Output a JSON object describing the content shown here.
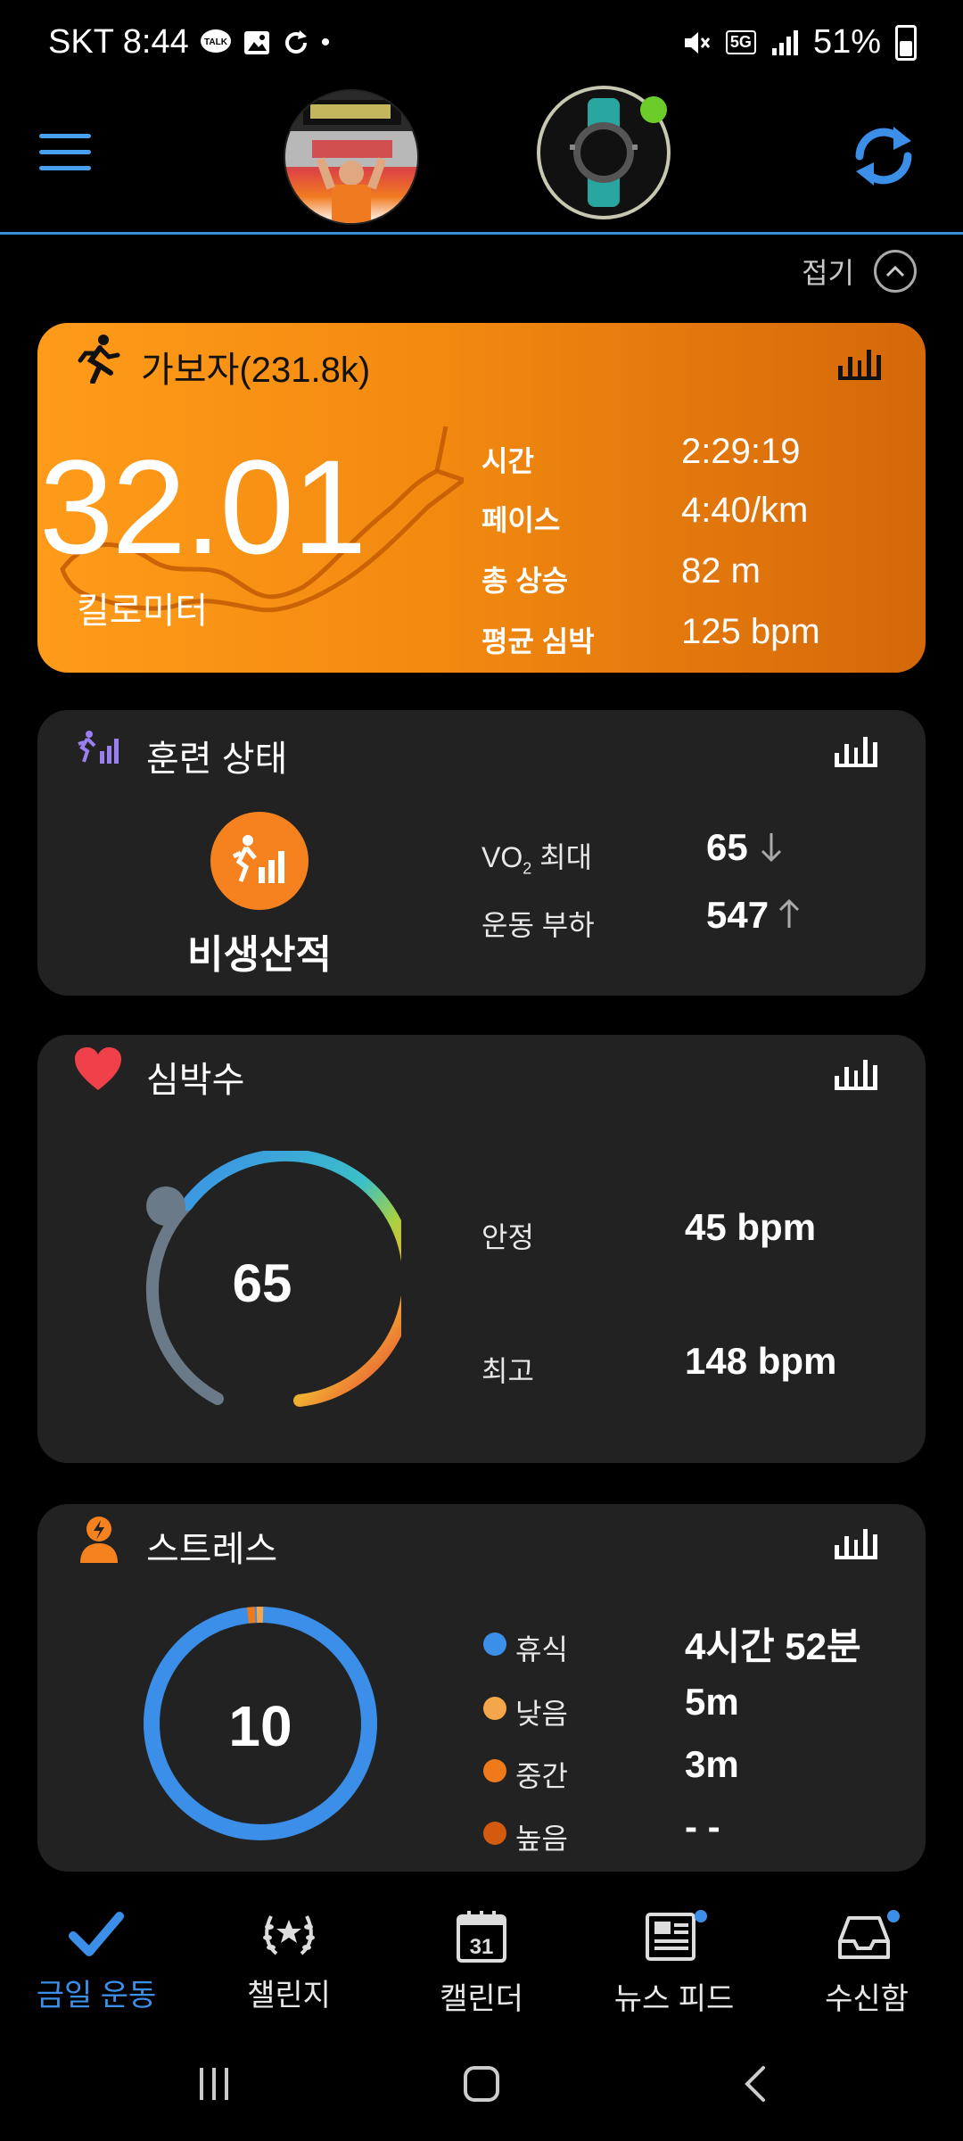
{
  "status_bar": {
    "carrier_time": "SKT 8:44",
    "network": "5G",
    "battery": "51%"
  },
  "header": {
    "avatar": "profile-photo",
    "device_connected_color": "#6ccc2a",
    "accent": "#3b8fd9"
  },
  "collapse_label": "접기",
  "activity": {
    "title": "가보자(231.8k)",
    "distance": "32.01",
    "unit": "킬로미터",
    "stats": [
      {
        "label": "시간",
        "value": "2:29:19"
      },
      {
        "label": "페이스",
        "value": "4:40/km"
      },
      {
        "label": "총 상승",
        "value": "82 m"
      },
      {
        "label": "평균 심박",
        "value": "125 bpm"
      }
    ]
  },
  "training": {
    "title": "훈련 상태",
    "status": "비생산적",
    "vo2_label_prefix": "VO",
    "vo2_label_sub": "2",
    "vo2_label_suffix": " 최대",
    "vo2_value": "65",
    "load_label": "운동 부하",
    "load_value": "547"
  },
  "heart": {
    "title": "심박수",
    "current": "65",
    "resting_label": "안정",
    "resting_value": "45 bpm",
    "max_label": "최고",
    "max_value": "148 bpm"
  },
  "stress": {
    "title": "스트레스",
    "value": "10",
    "items": [
      {
        "label": "휴식",
        "value": "4시간 52분",
        "color": "#3b8fe8"
      },
      {
        "label": "낮음",
        "value": "5m",
        "color": "#f5a54a"
      },
      {
        "label": "중간",
        "value": "3m",
        "color": "#f07a1a"
      },
      {
        "label": "높음",
        "value": "- -",
        "color": "#d45a10"
      }
    ]
  },
  "nav": [
    {
      "label": "금일 운동",
      "active": true
    },
    {
      "label": "챌린지"
    },
    {
      "label": "캘린더",
      "calendar_day": "31"
    },
    {
      "label": "뉴스 피드"
    },
    {
      "label": "수신함"
    }
  ]
}
